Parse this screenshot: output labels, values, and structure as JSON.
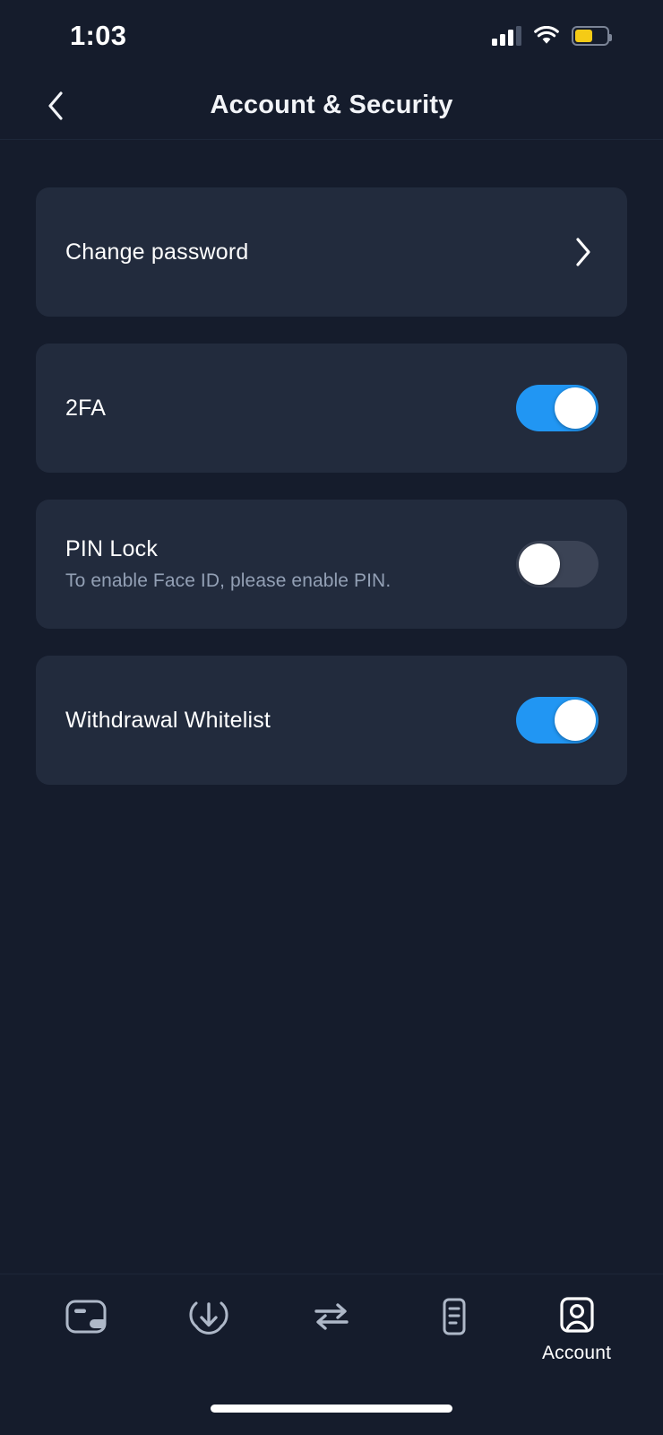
{
  "status_bar": {
    "time": "1:03",
    "signal_icon": "cellular-signal-icon",
    "signal_bars_filled": 3,
    "signal_bars_total": 4,
    "wifi_icon": "wifi-icon",
    "battery_icon": "battery-icon",
    "battery_level_percent": 55,
    "battery_color": "#f5cb16"
  },
  "header": {
    "back_icon": "chevron-left-icon",
    "title": "Account & Security"
  },
  "settings": {
    "items": [
      {
        "name": "change-password",
        "title": "Change password",
        "subtitle": "",
        "control": "chevron",
        "chevron_icon": "chevron-right-icon"
      },
      {
        "name": "two-factor-auth",
        "title": "2FA",
        "subtitle": "",
        "control": "toggle",
        "toggle_state": "on"
      },
      {
        "name": "pin-lock",
        "title": "PIN Lock",
        "subtitle": "To enable Face ID, please enable PIN.",
        "control": "toggle",
        "toggle_state": "off"
      },
      {
        "name": "withdrawal-whitelist",
        "title": "Withdrawal Whitelist",
        "subtitle": "",
        "control": "toggle",
        "toggle_state": "on"
      }
    ]
  },
  "bottom_nav": {
    "items": [
      {
        "name": "wallet",
        "icon": "wallet-icon",
        "label": "",
        "active": false
      },
      {
        "name": "deposit",
        "icon": "download-circle-icon",
        "label": "",
        "active": false
      },
      {
        "name": "transfer",
        "icon": "swap-arrows-icon",
        "label": "",
        "active": false
      },
      {
        "name": "history",
        "icon": "document-lines-icon",
        "label": "",
        "active": false
      },
      {
        "name": "account",
        "icon": "account-badge-icon",
        "label": "Account",
        "active": true
      }
    ]
  },
  "colors": {
    "background": "#151c2c",
    "card": "#222b3d",
    "toggle_on": "#2196f3",
    "toggle_off": "#3b4355",
    "text_primary": "#ffffff",
    "text_secondary": "#93a0b5",
    "nav_inactive": "#aeb8c8",
    "nav_active": "#ffffff"
  },
  "home_indicator": "home-indicator"
}
